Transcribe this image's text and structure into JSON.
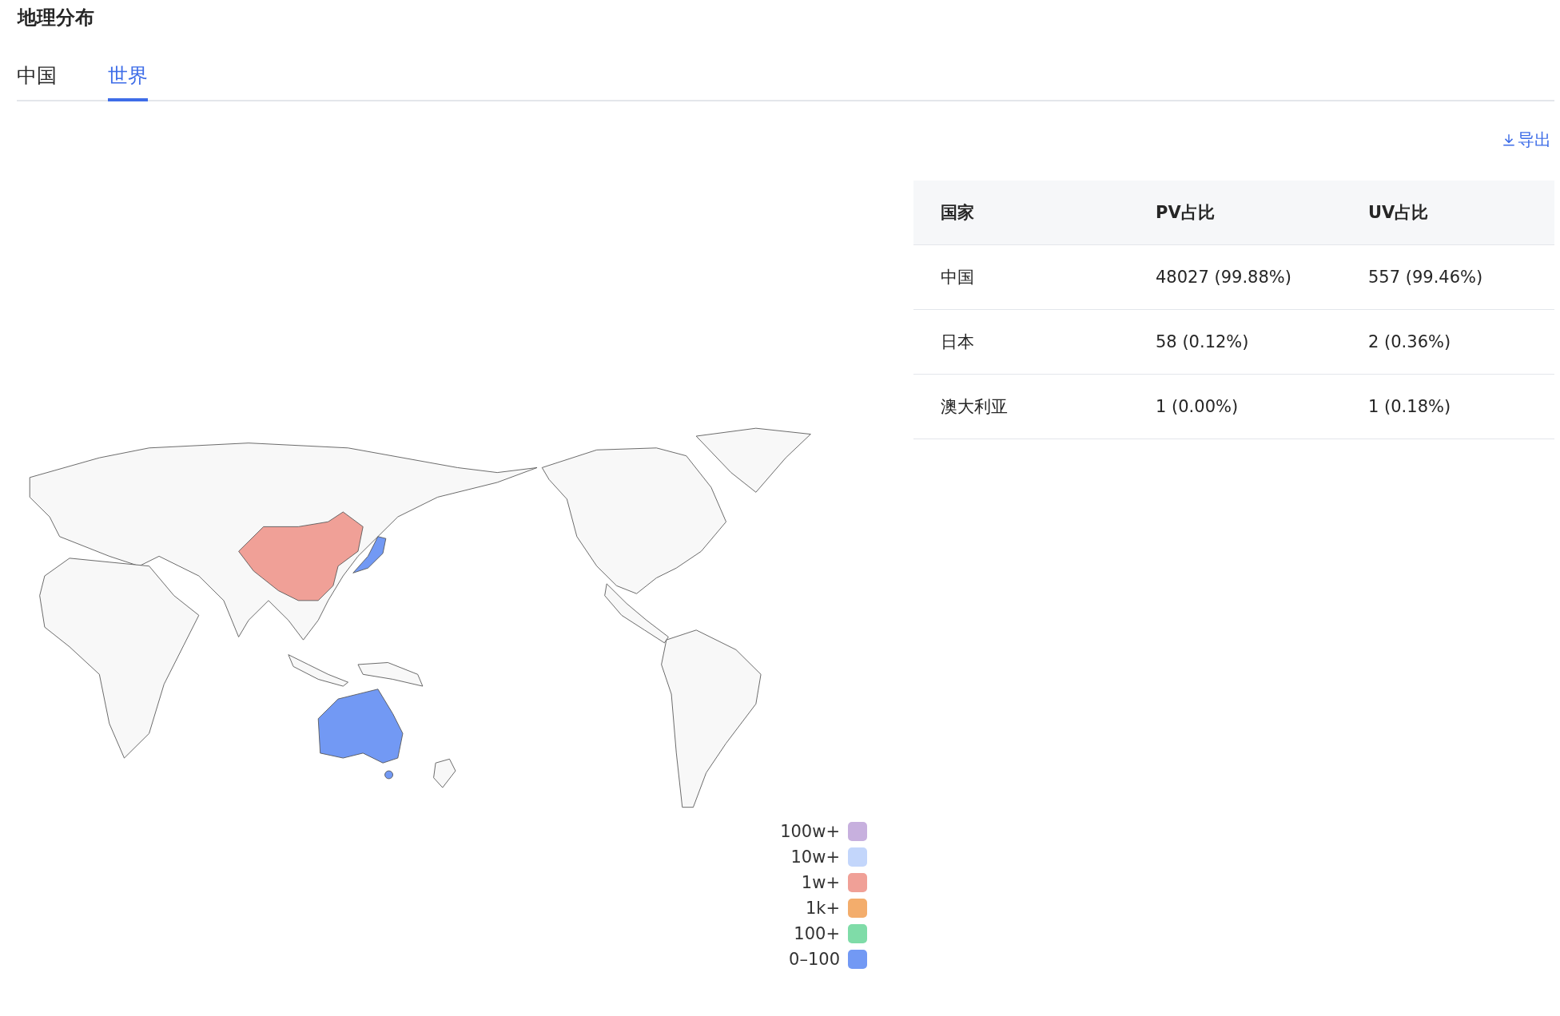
{
  "title": "地理分布",
  "tabs": [
    {
      "label": "中国",
      "selected": false
    },
    {
      "label": "世界",
      "selected": true
    }
  ],
  "export_button": {
    "label": "导出"
  },
  "table": {
    "columns": [
      "国家",
      "PV占比",
      "UV占比"
    ],
    "rows": [
      [
        "中国",
        "48027 (99.88%)",
        "557 (99.46%)"
      ],
      [
        "日本",
        "58 (0.12%)",
        "2 (0.36%)"
      ],
      [
        "澳大利亚",
        "1 (0.00%)",
        "1 (0.18%)"
      ]
    ]
  },
  "legend": [
    {
      "label": "100w+",
      "color": "#c7b0de"
    },
    {
      "label": "10w+",
      "color": "#c3d6fb"
    },
    {
      "label": "1w+",
      "color": "#f0a097"
    },
    {
      "label": "1k+",
      "color": "#f3ad6c"
    },
    {
      "label": "100+",
      "color": "#7fdca8"
    },
    {
      "label": "0–100",
      "color": "#7299f4"
    }
  ]
}
